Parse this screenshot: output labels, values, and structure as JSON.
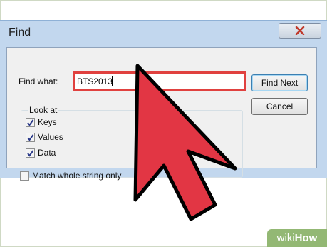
{
  "dialog": {
    "title": "Find",
    "close_icon": "close-icon"
  },
  "find": {
    "label": "Find what:",
    "value": "BTS2013",
    "highlight_color": "#e0413f"
  },
  "buttons": {
    "find_next": "Find Next",
    "cancel": "Cancel"
  },
  "look_at": {
    "title": "Look at",
    "options": [
      {
        "label": "Keys",
        "checked": true
      },
      {
        "label": "Values",
        "checked": true
      },
      {
        "label": "Data",
        "checked": true
      }
    ]
  },
  "match_whole": {
    "label": "Match whole string only",
    "checked": false
  },
  "overlay": {
    "icon": "pointer-arrow-icon",
    "color": "#e23644"
  },
  "watermark": {
    "prefix": "wiki",
    "suffix": "How",
    "color": "#93b874"
  }
}
